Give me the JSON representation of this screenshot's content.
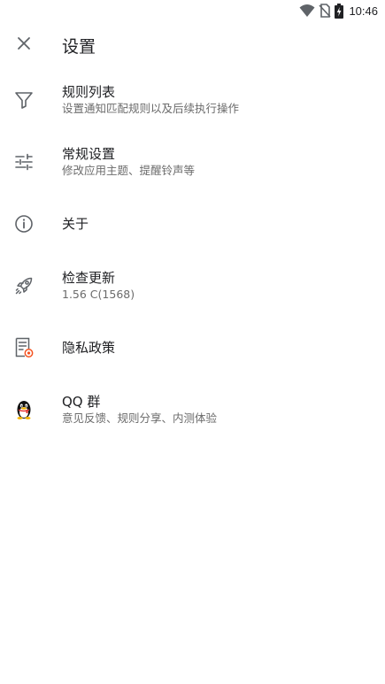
{
  "status_bar": {
    "time": "10:46",
    "icons": [
      "wifi-icon",
      "no-sim-icon",
      "battery-charging-icon"
    ]
  },
  "header": {
    "title": "设置",
    "close_icon": "close-icon"
  },
  "menu": {
    "items": [
      {
        "icon": "filter-icon",
        "title": "规则列表",
        "subtitle": "设置通知匹配规则以及后续执行操作"
      },
      {
        "icon": "sliders-icon",
        "title": "常规设置",
        "subtitle": "修改应用主题、提醒铃声等"
      },
      {
        "icon": "info-icon",
        "title": "关于",
        "subtitle": ""
      },
      {
        "icon": "rocket-icon",
        "title": "检查更新",
        "subtitle": "1.56 C(1568)"
      },
      {
        "icon": "privacy-document-icon",
        "title": "隐私政策",
        "subtitle": ""
      },
      {
        "icon": "qq-penguin-icon",
        "title": "QQ 群",
        "subtitle": "意见反馈、规则分享、内测体验"
      }
    ]
  },
  "colors": {
    "background": "#ffffff",
    "text_primary": "#202124",
    "text_secondary": "#6b6b6b",
    "icon": "#5f6368",
    "accent_orange": "#f4511e"
  }
}
